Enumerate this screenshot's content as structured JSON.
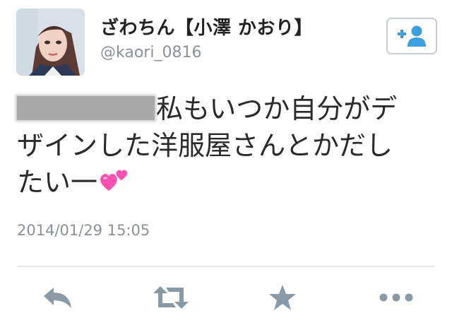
{
  "user": {
    "display_name": "ざわちん【小澤 かおり】",
    "handle": "@kaori_0816"
  },
  "tweet": {
    "line1": "私もいつか自分がデ",
    "line2": "ザインした洋服屋さんとかだし",
    "line3": "たい一"
  },
  "timestamp": "2014/01/29 15:05",
  "colors": {
    "icon": "#8a99a6",
    "follow_icon": "#3a9fe0",
    "text": "#2a2a2a",
    "muted": "#8a9198",
    "emoji": "#ff4fb0"
  },
  "actions": [
    {
      "name": "reply",
      "icon": "reply-icon"
    },
    {
      "name": "retweet",
      "icon": "retweet-icon"
    },
    {
      "name": "favorite",
      "icon": "star-icon"
    },
    {
      "name": "more",
      "icon": "more-icon"
    }
  ]
}
